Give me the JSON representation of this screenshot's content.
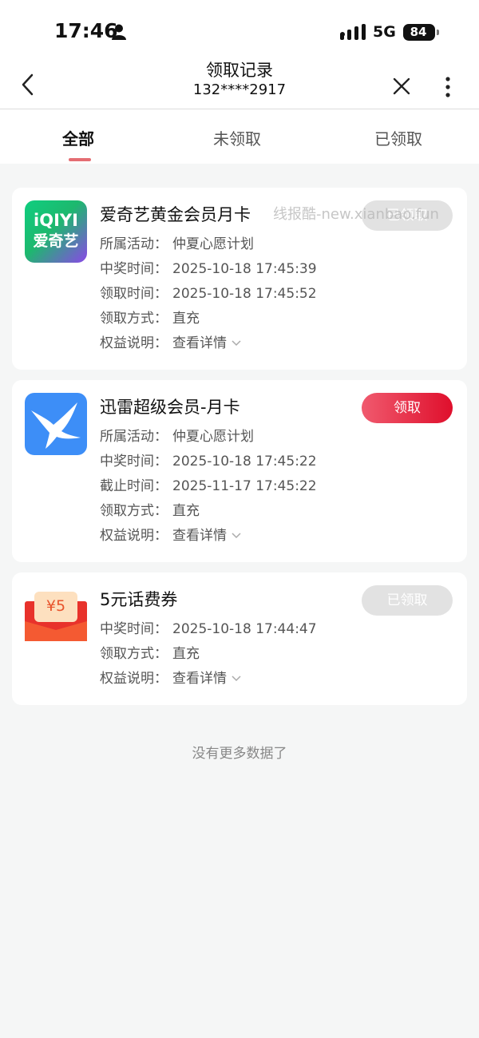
{
  "status_bar": {
    "time": "17:46",
    "network": "5G",
    "battery": "84",
    "person_icon": "person-icon",
    "signal_icon": "signal-icon"
  },
  "nav": {
    "title": "领取记录",
    "subtitle": "132****2917",
    "back_icon": "chevron-left-icon",
    "close_icon": "close-icon",
    "more_icon": "more-vertical-icon"
  },
  "tabs": [
    {
      "label": "全部",
      "active": true
    },
    {
      "label": "未领取",
      "active": false
    },
    {
      "label": "已领取",
      "active": false
    }
  ],
  "watermark": "线报酷-new.xianbao.fun",
  "cards": [
    {
      "title": "爱奇艺黄金会员月卡",
      "icon": "iqiyi-logo",
      "logo_text_top": "iQIYI",
      "logo_text_bottom": "爱奇艺",
      "button": "已领取",
      "button_state": "claimed",
      "lines": [
        {
          "label": "所属活动：",
          "value": "仲夏心愿计划"
        },
        {
          "label": "中奖时间：",
          "value": "2025-10-18 17:45:39"
        },
        {
          "label": "领取时间：",
          "value": "2025-10-18 17:45:52"
        },
        {
          "label": "领取方式：",
          "value": "直充"
        },
        {
          "label": "权益说明：",
          "value": "查看详情"
        }
      ]
    },
    {
      "title": "迅雷超级会员-月卡",
      "icon": "xunlei-bird-logo",
      "button": "领取",
      "button_state": "claim",
      "lines": [
        {
          "label": "所属活动：",
          "value": "仲夏心愿计划"
        },
        {
          "label": "中奖时间：",
          "value": "2025-10-18 17:45:22"
        },
        {
          "label": "截止时间：",
          "value": "2025-11-17 17:45:22"
        },
        {
          "label": "领取方式：",
          "value": "直充"
        },
        {
          "label": "权益说明：",
          "value": "查看详情"
        }
      ]
    },
    {
      "title": "5元话费券",
      "icon": "red-envelope-icon",
      "envelope_text": "¥5",
      "button": "已领取",
      "button_state": "claimed",
      "lines": [
        {
          "label": "中奖时间：",
          "value": "2025-10-18 17:44:47"
        },
        {
          "label": "领取方式：",
          "value": "直充"
        },
        {
          "label": "权益说明：",
          "value": "查看详情"
        }
      ]
    }
  ],
  "footer": {
    "no_more": "没有更多数据了"
  },
  "colors": {
    "accent": "#e46d73",
    "claim_button": "#df0f2c",
    "claimed_button": "#e2e2e2",
    "background": "#f5f6f6"
  }
}
